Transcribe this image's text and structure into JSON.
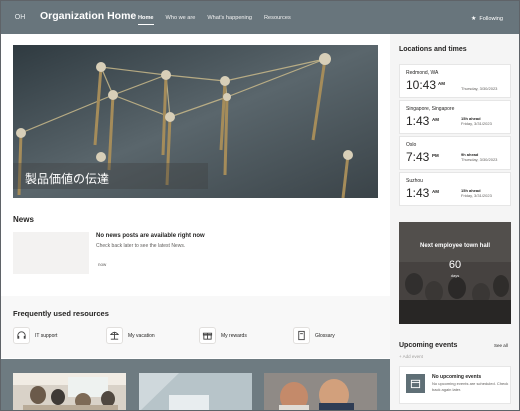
{
  "header": {
    "avatar": "OH",
    "title": "Organization Home",
    "nav": [
      "Home",
      "Who we are",
      "What's happening",
      "Resources"
    ],
    "follow_label": "Following",
    "bg_color": "#68757c"
  },
  "hero": {
    "caption": "製品価値の伝達"
  },
  "news": {
    "title": "News",
    "empty_head": "No news posts are available right now",
    "empty_sub": "Check back later to see the latest News.",
    "time": "now"
  },
  "frequent": {
    "title": "Frequently used resources",
    "items": [
      {
        "label": "IT support",
        "icon": "headset-icon"
      },
      {
        "label": "My vacation",
        "icon": "beach-icon"
      },
      {
        "label": "My rewards",
        "icon": "gift-icon"
      },
      {
        "label": "Glossary",
        "icon": "book-icon"
      }
    ]
  },
  "locations": {
    "title": "Locations and times",
    "items": [
      {
        "city": "Redmond, WA",
        "time": "10:43",
        "ampm": "AM",
        "offset": "",
        "date": "Thursday, 3/30/2023"
      },
      {
        "city": "Singapore, Singapore",
        "time": "1:43",
        "ampm": "AM",
        "offset": "15h ahead",
        "date": "Friday, 3/31/2023"
      },
      {
        "city": "Oslo",
        "time": "7:43",
        "ampm": "PM",
        "offset": "9h ahead",
        "date": "Thursday, 3/30/2023"
      },
      {
        "city": "Suzhou",
        "time": "1:43",
        "ampm": "AM",
        "offset": "15h ahead",
        "date": "Friday, 3/31/2023"
      }
    ]
  },
  "countdown": {
    "title": "Next employee town hall",
    "number": "60",
    "unit": "days"
  },
  "events": {
    "title": "Upcoming events",
    "see_all": "See all",
    "add": "+ Add event",
    "empty_head": "No upcoming events",
    "empty_sub": "No upcoming events are scheduled. Check back again later."
  }
}
